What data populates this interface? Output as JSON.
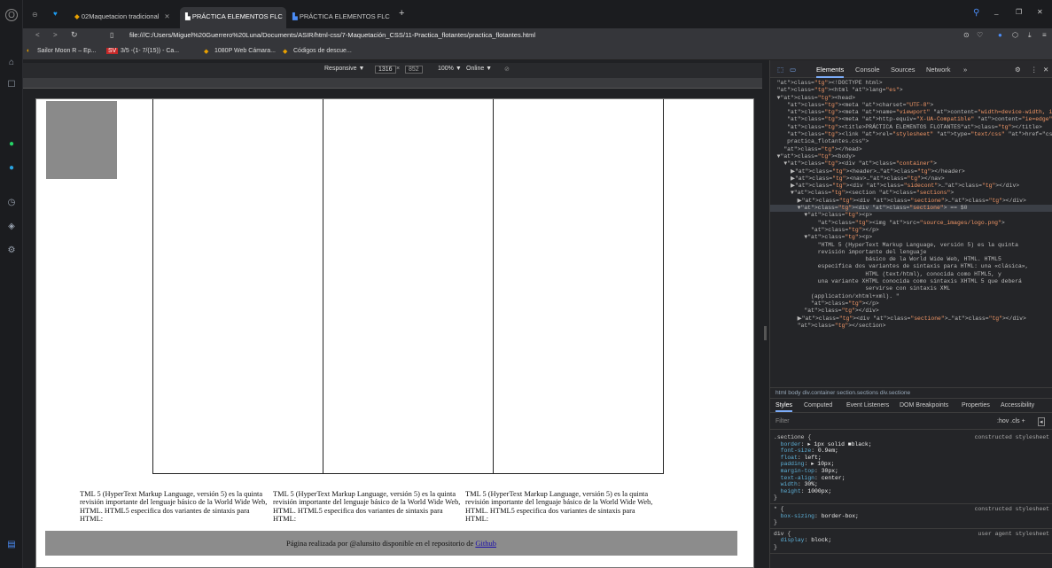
{
  "tabs": [
    {
      "label": "02Maquetacion tradicional",
      "active": false
    },
    {
      "label": "PRÁCTICA ELEMENTOS FLC",
      "active": true
    },
    {
      "label": "PRÁCTICA ELEMENTOS FLC",
      "active": false
    }
  ],
  "url": "file:///C:/Users/Miguel%20Guerrero%20Luna/Documents/ASIR/html-css/7-Maquetación_CSS/11-Practica_flotantes/practica_flotantes.html",
  "bookmarks": [
    "Sailor Moon R – Ep...",
    "3/5 -(1- 7/(15)) - Ca...",
    "1080P Web Cámara...",
    "Códigos de descue..."
  ],
  "device_toolbar": {
    "mode": "Responsive ▼",
    "width": "1316",
    "height": "852",
    "zoom": "100% ▼",
    "network": "Online ▼"
  },
  "page": {
    "paragraphs": [
      "TML 5 (HyperText Markup Language, versión 5) es la quinta revisión importante del lenguaje básico de la World Wide Web, HTML. HTML5 especifica dos variantes de sintaxis para HTML:",
      "TML 5 (HyperText Markup Language, versión 5) es la quinta revisión importante del lenguaje básico de la World Wide Web, HTML. HTML5 especifica dos variantes de sintaxis para HTML:",
      "TML 5 (HyperText Markup Language, versión 5) es la quinta revisión importante del lenguaje básico de la World Wide Web, HTML. HTML5 especifica dos variantes de sintaxis para HTML:"
    ],
    "footer_text": "Página realizada por @alunsito disponible en el repositorio de ",
    "footer_link": "Github"
  },
  "devtools": {
    "tabs": [
      "Elements",
      "Console",
      "Sources",
      "Network",
      "»"
    ],
    "code_lines": [
      "<!DOCTYPE html>",
      "<html lang=\"es\">",
      "▼<head>",
      "   <meta charset=\"UTF-8\">",
      "   <meta name=\"viewport\" content=\"width=device-width, initial-scale=1.0\">",
      "   <meta http-equiv=\"X-UA-Compatible\" content=\"ie=edge\">",
      "   <title>PRÁCTICA ELEMENTOS FLOTANTES</title>",
      "   <link rel=\"stylesheet\" type=\"text/css\" href=\"css/",
      "   practica_flotantes.css\">",
      "  </head>",
      "▼<body>",
      "  ▼<div class=\"container\">",
      "    ▶<header>…</header>",
      "    ▶<nav>…</nav>",
      "    ▶<div class=\"sidecont\">…</div>",
      "    ▼<section class=\"sections\">",
      "      ▶<div class=\"sectione\">…</div>",
      "      ▼<div class=\"sectione\"> == $0",
      "        ▼<p>",
      "            <img src=\"source_images/logo.png\">",
      "          </p>",
      "        ▼<p>",
      "            \"HTML 5 (HyperText Markup Language, versión 5) es la quinta",
      "            revisión importante del lenguaje",
      "                          básico de la World Wide Web, HTML. HTML5",
      "            especifica dos variantes de sintaxis para HTML: una «clásica»,",
      "                          HTML (text/html), conocida como HTML5, y",
      "            una variante XHTML conocida como sintaxis XHTML 5 que deberá",
      "                          servirse con sintaxis XML",
      "          (application/xhtml+xml). \"",
      "          </p>",
      "        </div>",
      "      ▶<div class=\"sectione\">…</div>",
      "      </section>"
    ],
    "breadcrumb": "html  body  div.container  section.sections  div.sectione",
    "style_tabs": [
      "Styles",
      "Computed",
      "Event Listeners",
      "DOM Breakpoints",
      "Properties",
      "Accessibility"
    ],
    "filter_placeholder": "Filter",
    "filter_tools": ":hov  .cls  +",
    "rules": [
      {
        "selector": ".sectione {",
        "source": "constructed stylesheet",
        "props": [
          [
            "border",
            "▸ 1px solid ■black;"
          ],
          [
            "font-size",
            "0.9em;"
          ],
          [
            "float",
            "left;"
          ],
          [
            "padding",
            "▸ 10px;"
          ],
          [
            "margin-top",
            "30px;"
          ],
          [
            "text-align",
            "center;"
          ],
          [
            "width",
            "30%;"
          ],
          [
            "height",
            "1000px;"
          ]
        ]
      },
      {
        "selector": "* {",
        "source": "constructed stylesheet",
        "props": [
          [
            "box-sizing",
            "border-box;"
          ]
        ]
      },
      {
        "selector": "div {",
        "source": "user agent stylesheet",
        "props": [
          [
            "display",
            "block;"
          ]
        ]
      }
    ]
  },
  "colors": {
    "accent": "#7cacf8",
    "page_bg": "#ffffff",
    "footer_bg": "#8c8c8c",
    "logo_gray": "#8a8a8a"
  }
}
